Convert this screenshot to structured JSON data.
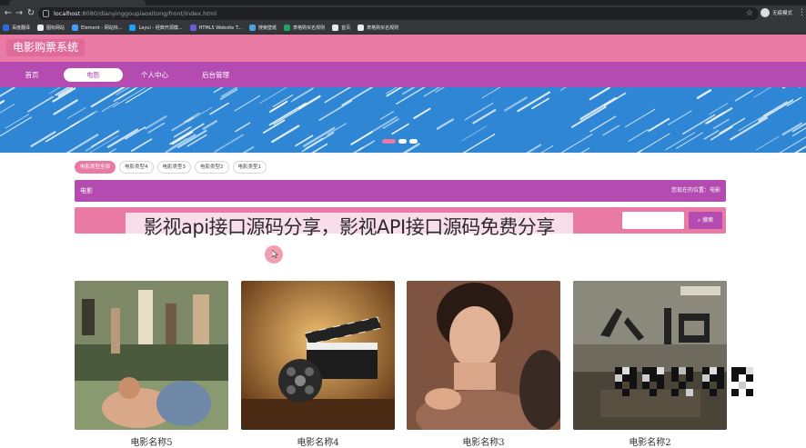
{
  "browser": {
    "url_host": "localhost",
    "url_path": ":8080/dianyinggoupiaoxitong/front/index.html",
    "profile_name": "无痕模式",
    "bookmarks": [
      {
        "label": "百度翻译",
        "color": "#2b6de0"
      },
      {
        "label": "图标网站",
        "color": "#e8eaed"
      },
      {
        "label": "Element - 网站快...",
        "color": "#409eff"
      },
      {
        "label": "Layui - 经典开源模...",
        "color": "#1e9fff"
      },
      {
        "label": "HTML5 Website T...",
        "color": "#6b5cd6"
      },
      {
        "label": "搜索壁纸",
        "color": "#4aa3df"
      },
      {
        "label": "表格购买名规则",
        "color": "#21a366"
      },
      {
        "label": "首页",
        "color": "#e8eaed"
      },
      {
        "label": "表格购买名规则",
        "color": "#e8eaed"
      }
    ]
  },
  "site": {
    "title": "电影购票系统",
    "nav": [
      {
        "label": "首页",
        "active": false
      },
      {
        "label": "电影",
        "active": true
      },
      {
        "label": "个人中心",
        "active": false
      },
      {
        "label": "后台管理",
        "active": false
      }
    ]
  },
  "categories": [
    {
      "label": "电影类型全部",
      "active": true
    },
    {
      "label": "电影类型4",
      "active": false
    },
    {
      "label": "电影类型3",
      "active": false
    },
    {
      "label": "电影类型2",
      "active": false
    },
    {
      "label": "电影类型1",
      "active": false
    }
  ],
  "breadcrumb": {
    "left": "电影",
    "right": "您现在的位置：电影"
  },
  "search": {
    "placeholder": "",
    "button_label": "搜索"
  },
  "overlay": {
    "watermark": "影视api接口源码分享，影视API接口源码免费分享"
  },
  "movies": [
    {
      "title": "电影名称5",
      "poster": "family-scene-poster"
    },
    {
      "title": "电影名称4",
      "poster": "film-reel-clapper-poster"
    },
    {
      "title": "电影名称3",
      "poster": "woman-portrait-poster"
    },
    {
      "title": "电影名称2",
      "poster": "war-film-poster"
    }
  ],
  "colors": {
    "header_pink": "#e87aa4",
    "nav_purple": "#b34bb0",
    "banner_blue": "#2e86d4"
  }
}
